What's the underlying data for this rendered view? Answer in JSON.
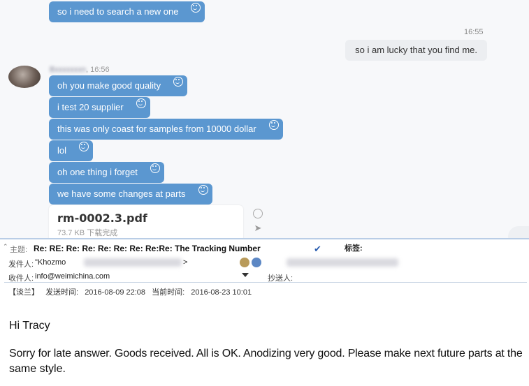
{
  "chat": {
    "incoming_top": "so i need to search a new one",
    "time_1": "16:55",
    "outgoing": "so i am lucky that you find me.",
    "sender_time": "16:56",
    "messages": [
      "oh you make good quality",
      "i test 20 supplier",
      "this was only coast for samples from 10000 dollar",
      "lol",
      "oh one thing i forget",
      "we have some changes at parts"
    ],
    "file": {
      "name": "rm-0002.3.pdf",
      "size": "73.7 KB",
      "status": "下载完成"
    }
  },
  "mail": {
    "subject_label": "主题:",
    "subject": "Re: RE: Re: Re: Re: Re: Re: Re:Re: The Tracking Number",
    "tag_label": "标签:",
    "from_label": "发件人:",
    "from_value": "\"Khozmo",
    "from_suffix": ">",
    "to_label": "收件人:",
    "to_value": "info@weimichina.com",
    "cc_label": "抄送人:",
    "read_label": "【淡兰】",
    "sent_label": "发送时间:",
    "sent_time": "2016-08-09 22:08",
    "current_label": "当前时间:",
    "current_time": "2016-08-23 10:01",
    "greeting": "Hi Tracy",
    "body_line1": "Sorry for late answer. Goods received. All is OK. Anodizing very good. Please make next future parts at the",
    "body_line2": "same style."
  },
  "colors": {
    "bubble_blue": "#5b97d0",
    "outgoing_bg": "#eceef1",
    "chat_bg": "#f7f8fa"
  }
}
